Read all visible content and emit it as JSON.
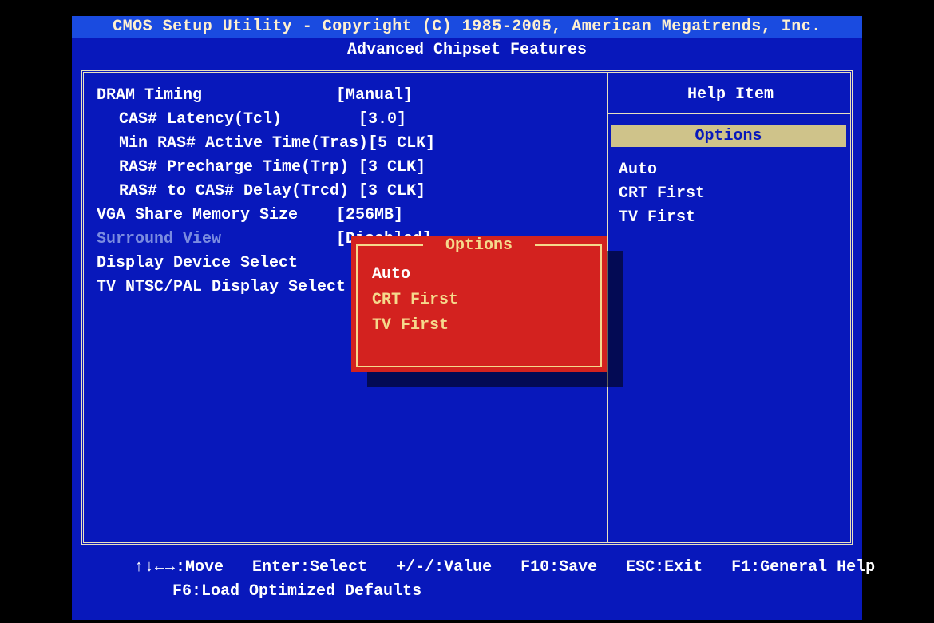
{
  "title": "CMOS Setup Utility - Copyright (C) 1985-2005, American Megatrends, Inc.",
  "subtitle": "Advanced Chipset Features",
  "settings": [
    {
      "label": "DRAM Timing",
      "value": "[Manual]",
      "indent": false,
      "dimmed": false
    },
    {
      "label": "CAS# Latency(Tcl)",
      "value": "[3.0]",
      "indent": true,
      "dimmed": false
    },
    {
      "label": "Min RAS# Active Time(Tras)",
      "value": "[5 CLK]",
      "indent": true,
      "dimmed": false
    },
    {
      "label": "RAS# Precharge Time(Trp)",
      "value": "[3 CLK]",
      "indent": true,
      "dimmed": false
    },
    {
      "label": "RAS# to CAS# Delay(Trcd)",
      "value": "[3 CLK]",
      "indent": true,
      "dimmed": false
    },
    {
      "label": "VGA Share Memory Size",
      "value": "[256MB]",
      "indent": false,
      "dimmed": false
    },
    {
      "label": "Surround View",
      "value": "[Disabled]",
      "indent": false,
      "dimmed": true
    },
    {
      "label": "Display Device Select",
      "value": "",
      "indent": false,
      "dimmed": false
    },
    {
      "label": "TV NTSC/PAL Display Select",
      "value": "",
      "indent": false,
      "dimmed": false
    }
  ],
  "help": {
    "title": "Help Item",
    "options_label": "Options",
    "options": [
      "Auto",
      "CRT First",
      "TV First"
    ]
  },
  "popup": {
    "title": "Options",
    "items": [
      "Auto",
      "CRT First",
      "TV First"
    ],
    "selected_index": 0
  },
  "footer": {
    "line1_arrows": "↑↓←→",
    "line1_rest": ":Move   Enter:Select   +/-/:Value   F10:Save   ESC:Exit   F1:General Help",
    "line2": "F6:Load Optimized Defaults"
  }
}
